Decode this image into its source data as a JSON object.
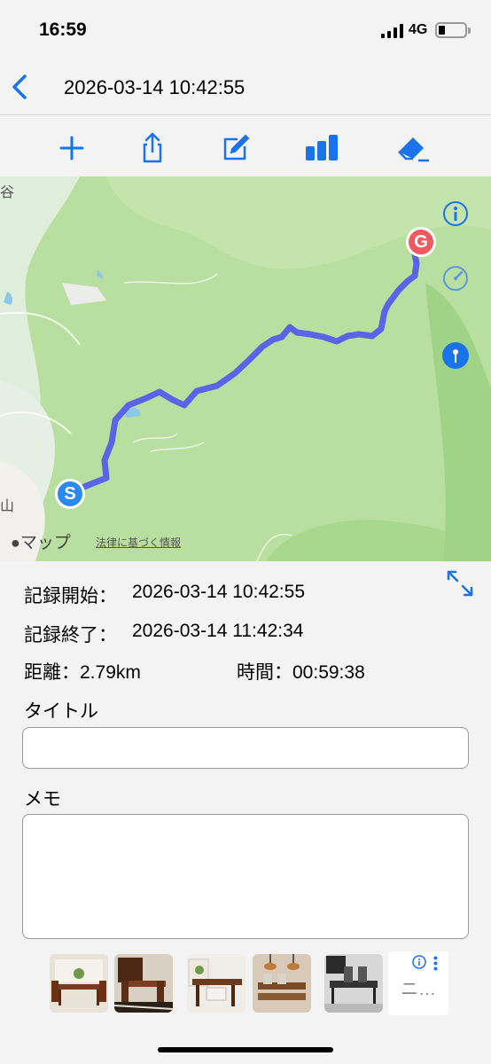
{
  "status_bar": {
    "time": "16:59",
    "network": "4G"
  },
  "nav": {
    "title": "2026-03-14 10:42:55"
  },
  "toolbar": {
    "icons": [
      "plus-icon",
      "share-icon",
      "edit-icon",
      "chart-icon",
      "eraser-icon"
    ]
  },
  "map": {
    "start_marker": "S",
    "goal_marker": "G",
    "logo_text": "マップ",
    "legal_link": "法律に基づく情報",
    "edge_label_top": "谷",
    "edge_label_bottom": "山",
    "route_color": "#5b63e6"
  },
  "record": {
    "start_label": "記録開始：",
    "start_value": "2026-03-14 10:42:55",
    "end_label": "記録終了：",
    "end_value": "2026-03-14 11:42:34",
    "distance_label": "距離：",
    "distance_value": "2.79km",
    "duration_label": "時間：",
    "duration_value": "00:59:38"
  },
  "form": {
    "title_label": "タイトル",
    "title_value": "",
    "memo_label": "メモ",
    "memo_value": ""
  },
  "thumbnails": {
    "count_shown": 5,
    "more_text": "ニ…"
  },
  "colors": {
    "accent": "#1a73e8",
    "map_green": "#b9dfa0",
    "start": "#2a8af2",
    "goal": "#f0595e"
  }
}
